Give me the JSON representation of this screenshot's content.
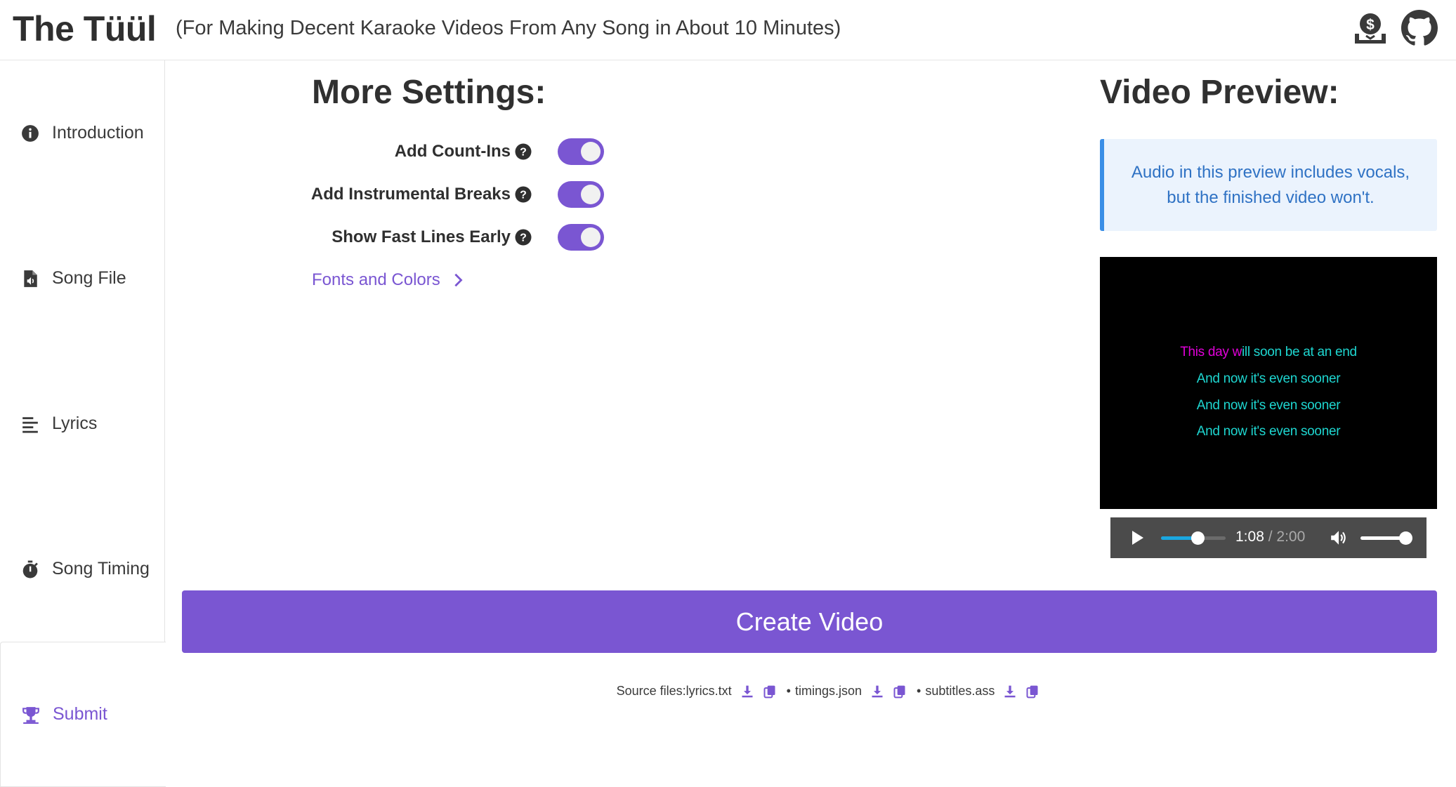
{
  "header": {
    "brand": "The Tüül",
    "tagline": "(For Making Decent Karaoke Videos From Any Song in About 10 Minutes)",
    "icons": [
      "donate-icon",
      "github-icon"
    ]
  },
  "sidebar": {
    "items": [
      {
        "label": "Introduction",
        "icon": "info-icon"
      },
      {
        "label": "Song File",
        "icon": "audio-file-icon"
      },
      {
        "label": "Lyrics",
        "icon": "lyrics-lines-icon"
      },
      {
        "label": "Song Timing",
        "icon": "stopwatch-icon"
      },
      {
        "label": "Submit",
        "icon": "trophy-icon",
        "active": true
      }
    ]
  },
  "settings": {
    "title": "More Settings:",
    "options": [
      {
        "label": "Add Count-Ins",
        "enabled": true
      },
      {
        "label": "Add Instrumental Breaks",
        "enabled": true
      },
      {
        "label": "Show Fast Lines Early",
        "enabled": true
      }
    ],
    "fonts_link": "Fonts and Colors"
  },
  "preview": {
    "title": "Video Preview:",
    "notice": "Audio in this preview includes vocals, but the finished video won't.",
    "lyrics": {
      "line1_sung": "This day",
      "line1_w": " w",
      "line1_rest": "ill soon be at an end",
      "line2": "And now it's even sooner",
      "line3": "And now it's even sooner",
      "line4": "And now it's even sooner"
    },
    "player": {
      "current_time": "1:08",
      "separator": "/",
      "duration": "2:00",
      "progress": 0.567,
      "volume": 1.0
    },
    "colors": {
      "sung": "#e000d8",
      "unsung": "#1ed6d0",
      "accent": "#7a56d2"
    }
  },
  "actions": {
    "create_video": "Create Video"
  },
  "source_files": {
    "prefix": "Source files: ",
    "files": [
      "lyrics.txt",
      "timings.json",
      "subtitles.ass"
    ],
    "bullet": "•"
  }
}
